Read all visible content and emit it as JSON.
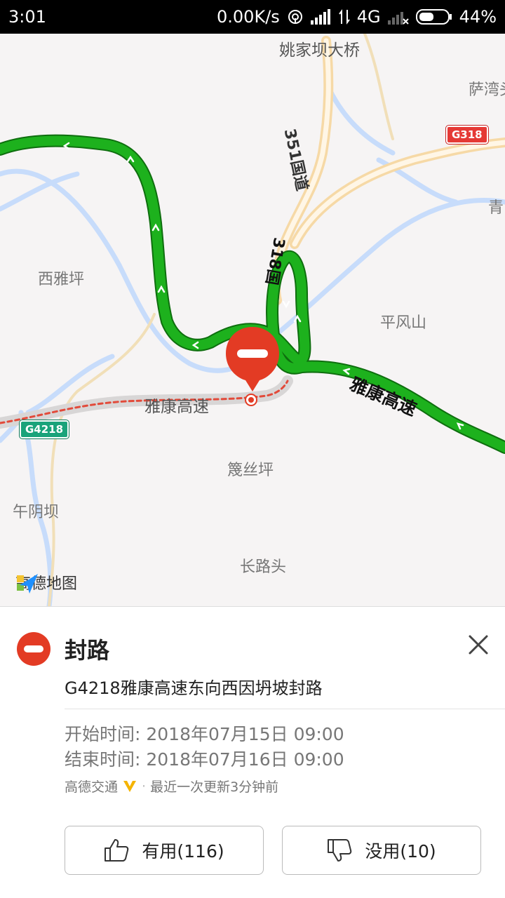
{
  "status_bar": {
    "time": "3:01",
    "net_speed": "0.00K/s",
    "network": "4G",
    "battery": "44%"
  },
  "map": {
    "labels": {
      "bridge": "姚家坝大桥",
      "sawan": "萨湾头",
      "qing": "青",
      "xiyaping": "西雅坪",
      "pingfengshan": "平风山",
      "yakang_left": "雅康高速",
      "yakang_right": "雅康高速",
      "gaisiping": "篾丝坪",
      "wuyinba": "午阴坝",
      "changlutou": "长路头",
      "g351": "351国道",
      "g318_vertical": "318国"
    },
    "shields": {
      "g318": "G318",
      "g4218": "G4218"
    },
    "logo": "高德地图",
    "colors": {
      "congestion_green": "#1db11d",
      "closure_red": "#e33b24"
    }
  },
  "panel": {
    "title": "封路",
    "description": "G4218雅康高速东向西因坍坡封路",
    "start_time": "开始时间: 2018年07月15日 09:00",
    "end_time": "结束时间: 2018年07月16日 09:00",
    "source": "高德交通",
    "source_separator": "·",
    "updated": "最近一次更新3分钟前",
    "useful_label": "有用(116)",
    "useless_label": "没用(10)"
  }
}
